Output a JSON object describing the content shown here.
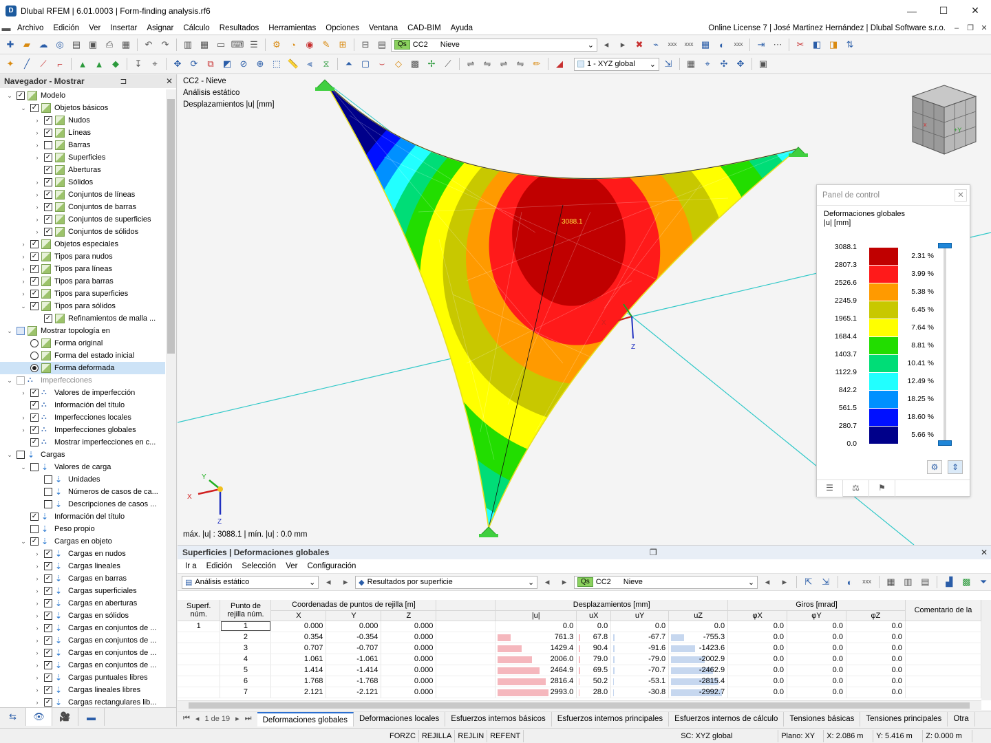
{
  "window": {
    "title": "Dlubal RFEM | 6.01.0003 | Form-finding analysis.rf6",
    "minimize": "—",
    "maximize": "☐",
    "close": "✕"
  },
  "menu": {
    "items": [
      "Archivo",
      "Edición",
      "Ver",
      "Insertar",
      "Asignar",
      "Cálculo",
      "Resultados",
      "Herramientas",
      "Opciones",
      "Ventana",
      "CAD-BIM",
      "Ayuda"
    ],
    "license": "Online License 7 | José Martinez Hernández | Dlubal Software s.r.o."
  },
  "toolbar1": {
    "lc_badge": "Qs",
    "lc_code": "CC2",
    "lc_name": "Nieve"
  },
  "toolbar2": {
    "coord_system": "1 - XYZ global"
  },
  "navigator": {
    "title": "Navegador - Mostrar",
    "rows": [
      {
        "l": 0,
        "exp": "v",
        "cb": "on",
        "icon": "mod",
        "label": "Modelo"
      },
      {
        "l": 1,
        "exp": "v",
        "cb": "on",
        "icon": "mod",
        "label": "Objetos básicos"
      },
      {
        "l": 2,
        "exp": ">",
        "cb": "on",
        "icon": "mod",
        "label": "Nudos"
      },
      {
        "l": 2,
        "exp": ">",
        "cb": "on",
        "icon": "mod",
        "label": "Líneas"
      },
      {
        "l": 2,
        "exp": ">",
        "cb": "off",
        "icon": "mod",
        "label": "Barras"
      },
      {
        "l": 2,
        "exp": ">",
        "cb": "on",
        "icon": "mod",
        "label": "Superficies"
      },
      {
        "l": 2,
        "exp": "",
        "cb": "on",
        "icon": "mod",
        "label": "Aberturas"
      },
      {
        "l": 2,
        "exp": ">",
        "cb": "on",
        "icon": "mod",
        "label": "Sólidos"
      },
      {
        "l": 2,
        "exp": ">",
        "cb": "on",
        "icon": "mod",
        "label": "Conjuntos de líneas"
      },
      {
        "l": 2,
        "exp": ">",
        "cb": "on",
        "icon": "mod",
        "label": "Conjuntos de barras"
      },
      {
        "l": 2,
        "exp": ">",
        "cb": "on",
        "icon": "mod",
        "label": "Conjuntos de superficies"
      },
      {
        "l": 2,
        "exp": ">",
        "cb": "on",
        "icon": "mod",
        "label": "Conjuntos de sólidos"
      },
      {
        "l": 1,
        "exp": ">",
        "cb": "on",
        "icon": "mod",
        "label": "Objetos especiales"
      },
      {
        "l": 1,
        "exp": ">",
        "cb": "on",
        "icon": "mod",
        "label": "Tipos para nudos"
      },
      {
        "l": 1,
        "exp": ">",
        "cb": "on",
        "icon": "mod",
        "label": "Tipos para líneas"
      },
      {
        "l": 1,
        "exp": ">",
        "cb": "on",
        "icon": "mod",
        "label": "Tipos para barras"
      },
      {
        "l": 1,
        "exp": ">",
        "cb": "on",
        "icon": "mod",
        "label": "Tipos para superficies"
      },
      {
        "l": 1,
        "exp": "v",
        "cb": "on",
        "icon": "mod",
        "label": "Tipos para sólidos"
      },
      {
        "l": 2,
        "exp": "",
        "cb": "on",
        "icon": "mod",
        "label": "Refinamientos de malla ..."
      },
      {
        "l": 0,
        "exp": "v",
        "cb": "part",
        "icon": "mod",
        "label": "Mostrar topología en"
      },
      {
        "l": 1,
        "exp": "",
        "cb": "radio",
        "icon": "mod",
        "label": "Forma original"
      },
      {
        "l": 1,
        "exp": "",
        "cb": "radio",
        "icon": "mod",
        "label": "Forma del estado inicial"
      },
      {
        "l": 1,
        "exp": "",
        "cb": "radio-on",
        "icon": "mod",
        "label": "Forma deformada",
        "sel": true
      },
      {
        "l": 0,
        "exp": "v",
        "cb": "dim",
        "icon": "imp",
        "label": "Imperfecciones",
        "gray": true
      },
      {
        "l": 1,
        "exp": ">",
        "cb": "on",
        "icon": "imp",
        "label": "Valores de imperfección"
      },
      {
        "l": 1,
        "exp": "",
        "cb": "on",
        "icon": "imp",
        "label": "Información del título"
      },
      {
        "l": 1,
        "exp": ">",
        "cb": "on",
        "icon": "imp",
        "label": "Imperfecciones locales"
      },
      {
        "l": 1,
        "exp": ">",
        "cb": "on",
        "icon": "imp",
        "label": "Imperfecciones globales"
      },
      {
        "l": 1,
        "exp": "",
        "cb": "on",
        "icon": "imp",
        "label": "Mostrar imperfecciones en c..."
      },
      {
        "l": 0,
        "exp": "v",
        "cb": "off",
        "icon": "load",
        "label": "Cargas"
      },
      {
        "l": 1,
        "exp": "v",
        "cb": "off",
        "icon": "load",
        "label": "Valores de carga"
      },
      {
        "l": 2,
        "exp": "",
        "cb": "off",
        "icon": "load",
        "label": "Unidades"
      },
      {
        "l": 2,
        "exp": "",
        "cb": "off",
        "icon": "load",
        "label": "Números de casos de ca..."
      },
      {
        "l": 2,
        "exp": "",
        "cb": "off",
        "icon": "load",
        "label": "Descripciones de casos ..."
      },
      {
        "l": 1,
        "exp": "",
        "cb": "on",
        "icon": "load",
        "label": "Información del título"
      },
      {
        "l": 1,
        "exp": "",
        "cb": "off",
        "icon": "load",
        "label": "Peso propio"
      },
      {
        "l": 1,
        "exp": "v",
        "cb": "on",
        "icon": "load",
        "label": "Cargas en objeto"
      },
      {
        "l": 2,
        "exp": ">",
        "cb": "on",
        "icon": "load",
        "label": "Cargas en nudos"
      },
      {
        "l": 2,
        "exp": ">",
        "cb": "on",
        "icon": "load",
        "label": "Cargas lineales"
      },
      {
        "l": 2,
        "exp": ">",
        "cb": "on",
        "icon": "load",
        "label": "Cargas en barras"
      },
      {
        "l": 2,
        "exp": ">",
        "cb": "on",
        "icon": "load",
        "label": "Cargas superficiales"
      },
      {
        "l": 2,
        "exp": ">",
        "cb": "on",
        "icon": "load",
        "label": "Cargas en aberturas"
      },
      {
        "l": 2,
        "exp": ">",
        "cb": "on",
        "icon": "load",
        "label": "Cargas en sólidos"
      },
      {
        "l": 2,
        "exp": ">",
        "cb": "on",
        "icon": "load",
        "label": "Cargas en conjuntos de ..."
      },
      {
        "l": 2,
        "exp": ">",
        "cb": "on",
        "icon": "load",
        "label": "Cargas en conjuntos de ..."
      },
      {
        "l": 2,
        "exp": ">",
        "cb": "on",
        "icon": "load",
        "label": "Cargas en conjuntos de ..."
      },
      {
        "l": 2,
        "exp": ">",
        "cb": "on",
        "icon": "load",
        "label": "Cargas en conjuntos de ..."
      },
      {
        "l": 2,
        "exp": ">",
        "cb": "on",
        "icon": "load",
        "label": "Cargas puntuales libres"
      },
      {
        "l": 2,
        "exp": ">",
        "cb": "on",
        "icon": "load",
        "label": "Cargas lineales libres"
      },
      {
        "l": 2,
        "exp": ">",
        "cb": "on",
        "icon": "load",
        "label": "Cargas rectangulares lib..."
      }
    ]
  },
  "view": {
    "info": [
      "CC2 - Nieve",
      "Análisis estático",
      "Desplazamientos |u| [mm]"
    ],
    "max_label": "3088.1",
    "footer": "máx. |u| : 3088.1 | mín. |u| : 0.0 mm",
    "axis": {
      "x": "X",
      "y": "Y",
      "z": "Z"
    }
  },
  "control_panel": {
    "title": "Panel de control",
    "legend_title": "Deformaciones globales",
    "legend_unit": "|u| [mm]",
    "values": [
      "3088.1",
      "2807.3",
      "2526.6",
      "2245.9",
      "1965.1",
      "1684.4",
      "1403.7",
      "1122.9",
      "842.2",
      "561.5",
      "280.7",
      "0.0"
    ],
    "colors": [
      "#c00000",
      "#ff1a1a",
      "#ff9a00",
      "#c8c800",
      "#ffff00",
      "#22dd00",
      "#00dd77",
      "#22ffff",
      "#0090ff",
      "#0010ff",
      "#00008a"
    ],
    "percents": [
      "2.31 %",
      "3.99 %",
      "5.38 %",
      "6.45 %",
      "7.64 %",
      "8.81 %",
      "10.41 %",
      "12.49 %",
      "18.25 %",
      "18.60 %",
      "5.66 %"
    ]
  },
  "table_panel": {
    "title": "Superficies | Deformaciones globales",
    "menu": [
      "Ir a",
      "Edición",
      "Selección",
      "Ver",
      "Configuración"
    ],
    "analysis": "Análisis estático",
    "result_type": "Resultados por superficie",
    "lc_badge": "Qs",
    "lc_code": "CC2",
    "lc_name": "Nieve",
    "group_headers": {
      "coords": "Coordenadas de puntos de rejilla [m]",
      "disp": "Desplazamientos [mm]",
      "rot": "Giros [mrad]",
      "comment": "Comentario de la"
    },
    "columns": [
      "Superf. núm.",
      "Punto de rejilla núm.",
      "X",
      "Y",
      "Z",
      "|u|",
      "uX",
      "uY",
      "uZ",
      "φX",
      "φY",
      "φZ"
    ],
    "col_surf_1": "Superf.",
    "col_surf_2": "núm.",
    "col_pt_1": "Punto de",
    "col_pt_2": "rejilla núm.",
    "surface_no": "1",
    "rows": [
      [
        "1",
        "0.000",
        "0.000",
        "0.000",
        "0.0",
        "0.0",
        "0.0",
        "0.0",
        "0.0",
        "0.0",
        "0.0"
      ],
      [
        "2",
        "0.354",
        "-0.354",
        "0.000",
        "761.3",
        "67.8",
        "-67.7",
        "-755.3",
        "0.0",
        "0.0",
        "0.0"
      ],
      [
        "3",
        "0.707",
        "-0.707",
        "0.000",
        "1429.4",
        "90.4",
        "-91.6",
        "-1423.6",
        "0.0",
        "0.0",
        "0.0"
      ],
      [
        "4",
        "1.061",
        "-1.061",
        "0.000",
        "2006.0",
        "79.0",
        "-79.0",
        "-2002.9",
        "0.0",
        "0.0",
        "0.0"
      ],
      [
        "5",
        "1.414",
        "-1.414",
        "0.000",
        "2464.9",
        "69.5",
        "-70.7",
        "-2462.9",
        "0.0",
        "0.0",
        "0.0"
      ],
      [
        "6",
        "1.768",
        "-1.768",
        "0.000",
        "2816.4",
        "50.2",
        "-53.1",
        "-2815.4",
        "0.0",
        "0.0",
        "0.0"
      ],
      [
        "7",
        "2.121",
        "-2.121",
        "0.000",
        "2993.0",
        "28.0",
        "-30.8",
        "-2992.7",
        "0.0",
        "0.0",
        "0.0"
      ]
    ],
    "pager": "1 de 19",
    "tabs": [
      "Deformaciones globales",
      "Deformaciones locales",
      "Esfuerzos internos básicos",
      "Esfuerzos internos principales",
      "Esfuerzos internos de cálculo",
      "Tensiones básicas",
      "Tensiones principales",
      "Otra"
    ]
  },
  "status": {
    "items": [
      "FORZC",
      "REJILLA",
      "REJLIN",
      "REFENT"
    ],
    "cs": "SC: XYZ global",
    "plane": "Plano: XY",
    "x": "X: 2.086 m",
    "y": "Y: 5.416 m",
    "z": "Z: 0.000 m"
  }
}
